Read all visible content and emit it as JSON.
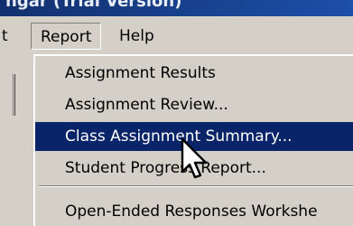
{
  "window": {
    "title": "ngar (Trial Version)"
  },
  "menubar": {
    "items": [
      {
        "label": "t"
      },
      {
        "label": "Report"
      },
      {
        "label": "Help"
      }
    ]
  },
  "report_menu": {
    "items": [
      {
        "label": "Assignment Results"
      },
      {
        "label": "Assignment Review..."
      },
      {
        "label": "Class Assignment Summary..."
      },
      {
        "label": "Student Progress Report..."
      },
      {
        "label": "Open-Ended Responses Workshe"
      }
    ],
    "selected_index": 2
  },
  "colors": {
    "selection": "#0a246a",
    "menu_bg": "#d4d0c8",
    "titlebar": "#12306e"
  },
  "icons": {
    "cursor": "arrow-cursor-icon"
  }
}
